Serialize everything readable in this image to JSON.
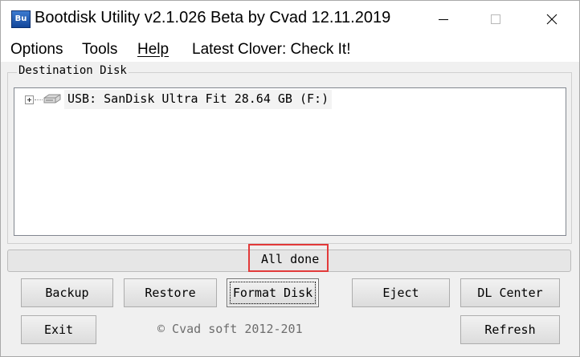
{
  "window": {
    "title": "Bootdisk Utility v2.1.026 Beta by Cvad 12.11.2019",
    "icon_text": "Bu",
    "icon": "bootdisk-app-icon",
    "controls": [
      "minimize-icon",
      "maximize-icon",
      "close-icon"
    ]
  },
  "menu": {
    "options": "Options",
    "tools": "Tools",
    "help": "Help",
    "clover": "Latest Clover: Check It!"
  },
  "destination": {
    "label": "Destination Disk",
    "tree": [
      {
        "label": "USB: SanDisk Ultra Fit 28.64 GB (F:)",
        "icon": "usb-disk-icon",
        "expandable": true
      }
    ]
  },
  "status": {
    "text": "All done",
    "highlight_color": "#e23a3a"
  },
  "buttons": {
    "backup": "Backup",
    "restore": "Restore",
    "format": "Format Disk",
    "eject": "Eject",
    "dl_center": "DL Center",
    "exit": "Exit",
    "refresh": "Refresh"
  },
  "footer": {
    "copyright": "© Cvad soft 2012-201"
  }
}
